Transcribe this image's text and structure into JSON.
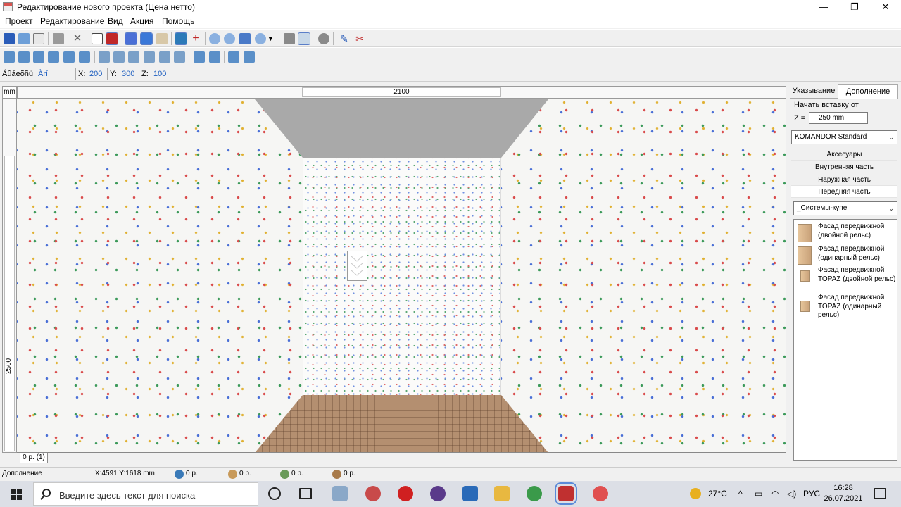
{
  "window": {
    "title": "Редактирование нового проекта (Цена нетто)",
    "minimize": "—",
    "maximize": "❐",
    "close": "✕"
  },
  "menu": [
    "Проект",
    "Редактирование",
    "Вид",
    "Акция",
    "Помощь"
  ],
  "coords": {
    "mode_label": "Äûáeõñü",
    "mode_value": "Àrí",
    "x_label": "X:",
    "x_value": "200",
    "y_label": "Y:",
    "y_value": "300",
    "z_label": "Z:",
    "z_value": "100"
  },
  "ruler": {
    "unit": "mm",
    "width": "2100",
    "height": "2500"
  },
  "sheet_tab": "0 p. (1)",
  "right_panel": {
    "tabs": [
      "Указывание",
      "Дополнение"
    ],
    "insert_from_label": "Начать вставку от",
    "z_label": "Z =",
    "z_value": "250 mm",
    "catalog": "KOMANDOR Standard",
    "categories": [
      "Аксесуары",
      "Внутренняя часть",
      "Наружная часть",
      "Передняя часть"
    ],
    "subcategory": "_Системы-купе",
    "items": [
      "Фасад передвижной (двойной рельс)",
      "Фасад передвижной (одинарный рельс)",
      "Фасад передвижной TOPAZ (двойной рельс)",
      "Фасад передвижной TOPAZ (одинарный рельс)"
    ]
  },
  "status": {
    "mode": "Дополнение",
    "cursor": "X:4591  Y:1618  mm",
    "price1": "0 р.",
    "price2": "0 р.",
    "price3": "0 р.",
    "price4": "0 р."
  },
  "taskbar": {
    "search_placeholder": "Введите здесь текст для поиска",
    "weather": "27°C",
    "lang": "РУС",
    "time": "16:28",
    "date": "26.07.2021"
  }
}
